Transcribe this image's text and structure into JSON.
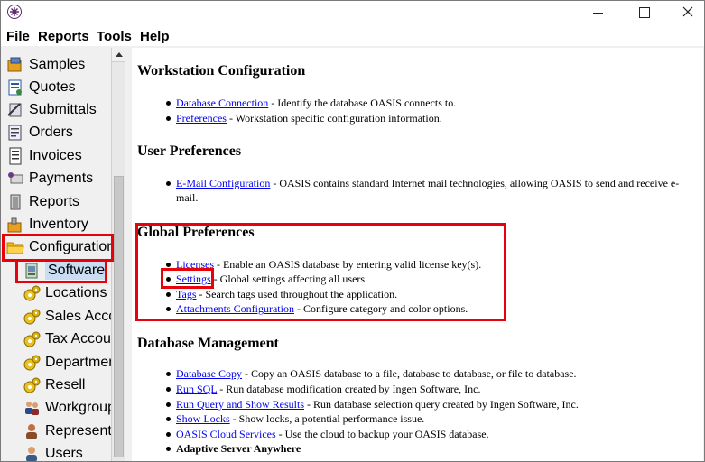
{
  "menu": [
    "File",
    "Reports",
    "Tools",
    "Help"
  ],
  "sidebar": {
    "items": [
      {
        "label": "Samples",
        "icon": "samples-icon",
        "level": 0
      },
      {
        "label": "Quotes",
        "icon": "quotes-icon",
        "level": 0
      },
      {
        "label": "Submittals",
        "icon": "submittals-icon",
        "level": 0
      },
      {
        "label": "Orders",
        "icon": "orders-icon",
        "level": 0
      },
      {
        "label": "Invoices",
        "icon": "invoices-icon",
        "level": 0
      },
      {
        "label": "Payments",
        "icon": "payments-icon",
        "level": 0
      },
      {
        "label": "Reports",
        "icon": "reports-icon",
        "level": 0
      },
      {
        "label": "Inventory",
        "icon": "inventory-icon",
        "level": 0
      },
      {
        "label": "Configuration",
        "icon": "folder-open-icon",
        "level": 0
      },
      {
        "label": "Software",
        "icon": "software-icon",
        "level": 1,
        "selected": true
      },
      {
        "label": "Locations",
        "icon": "gear-icon",
        "level": 1
      },
      {
        "label": "Sales Acco",
        "icon": "gear-icon",
        "level": 1
      },
      {
        "label": "Tax Accou",
        "icon": "gear-icon",
        "level": 1
      },
      {
        "label": "Departmen",
        "icon": "gear-icon",
        "level": 1
      },
      {
        "label": "Resell",
        "icon": "gear-icon",
        "level": 1
      },
      {
        "label": "Workgroup",
        "icon": "users-icon",
        "level": 1
      },
      {
        "label": "Representa",
        "icon": "representative-icon",
        "level": 1
      },
      {
        "label": "Users",
        "icon": "user-icon",
        "level": 1
      }
    ]
  },
  "content": {
    "workstation": {
      "heading": "Workstation Configuration",
      "items": [
        {
          "link": "Database Connection",
          "desc": " - Identify the database OASIS connects to."
        },
        {
          "link": "Preferences",
          "desc": " - Workstation specific configuration information."
        }
      ]
    },
    "user_prefs": {
      "heading": "User Preferences",
      "items": [
        {
          "link": "E-Mail Configuration",
          "desc": " - OASIS contains standard Internet mail technologies, allowing OASIS to send and receive e-mail."
        }
      ]
    },
    "global_prefs": {
      "heading": "Global Preferences",
      "items": [
        {
          "link": "Licenses",
          "desc": " - Enable an OASIS database by entering valid license key(s)."
        },
        {
          "link": "Settings",
          "desc": " - Global settings affecting all users."
        },
        {
          "link": "Tags",
          "desc": " - Search tags used throughout the application."
        },
        {
          "link": "Attachments Configuration",
          "desc": " - Configure category and color options."
        }
      ]
    },
    "db_mgmt": {
      "heading": "Database Management",
      "items": [
        {
          "link": "Database Copy",
          "desc": " - Copy an OASIS database to a file, database to database, or file to database."
        },
        {
          "link": "Run SQL",
          "desc": " - Run database modification created by Ingen Software, Inc."
        },
        {
          "link": "Run Query and Show Results",
          "desc": " - Run database selection query created by Ingen Software, Inc."
        },
        {
          "link": "Show Locks",
          "desc": " - Show locks, a potential performance issue."
        },
        {
          "link": "OASIS Cloud Services",
          "desc": " - Use the cloud to backup your OASIS database."
        }
      ],
      "bold_item": "Adaptive Server Anywhere"
    }
  },
  "colors": {
    "highlight": "#e8000b",
    "link": "#0000ee",
    "selection": "#c8dcf2"
  }
}
